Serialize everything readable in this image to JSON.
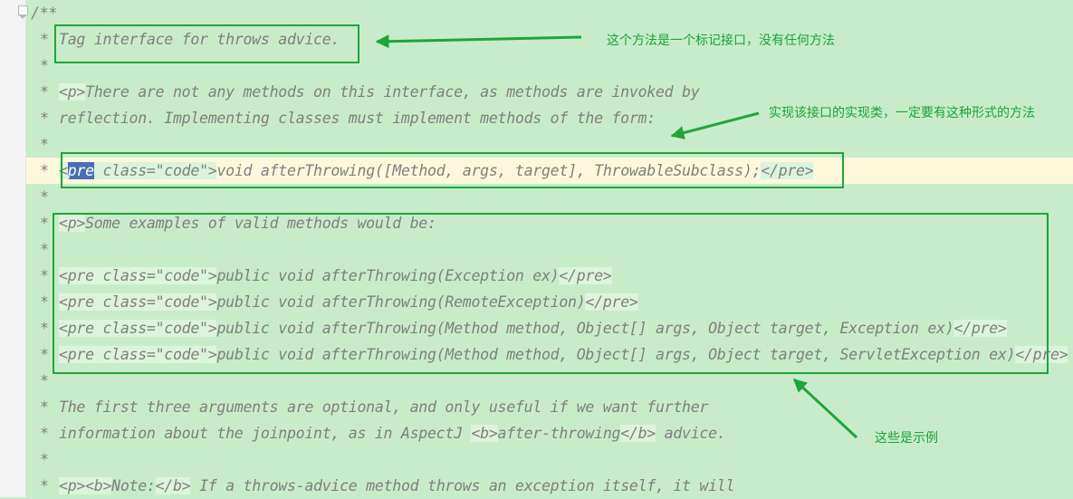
{
  "editor": {
    "lines": [
      {
        "star": "",
        "text": "/**",
        "first": true
      },
      {
        "star": "*",
        "text": "Tag interface for throws advice."
      },
      {
        "star": "*",
        "text": ""
      },
      {
        "star": "*",
        "text": "<p>There are not any methods on this interface, as methods are invoked by"
      },
      {
        "star": "*",
        "text": "reflection. Implementing classes must implement methods of the form:"
      },
      {
        "star": "*",
        "text": ""
      },
      {
        "star": "*",
        "text": "<pre class=\"code\">void afterThrowing([Method, args, target], ThrowableSubclass);</pre>",
        "highlight": true
      },
      {
        "star": "*",
        "text": ""
      },
      {
        "star": "*",
        "text": "<p>Some examples of valid methods would be:"
      },
      {
        "star": "*",
        "text": ""
      },
      {
        "star": "*",
        "text": "<pre class=\"code\">public void afterThrowing(Exception ex)</pre>"
      },
      {
        "star": "*",
        "text": "<pre class=\"code\">public void afterThrowing(RemoteException)</pre>"
      },
      {
        "star": "*",
        "text": "<pre class=\"code\">public void afterThrowing(Method method, Object[] args, Object target, Exception ex)</pre>"
      },
      {
        "star": "*",
        "text": "<pre class=\"code\">public void afterThrowing(Method method, Object[] args, Object target, ServletException ex)</pre>"
      },
      {
        "star": "*",
        "text": ""
      },
      {
        "star": "*",
        "text": "The first three arguments are optional, and only useful if we want further"
      },
      {
        "star": "*",
        "text": "information about the joinpoint, as in AspectJ <b>after-throwing</b> advice."
      },
      {
        "star": "*",
        "text": ""
      },
      {
        "star": "*",
        "text": "<p><b>Note:</b> If a throws-advice method throws an exception itself, it will"
      }
    ]
  },
  "annotations": {
    "marker_interface": "这个方法是一个标记接口，没有任何方法",
    "method_form": "实现该接口的实现类，一定要有这种形式的方法",
    "examples": "这些是示例"
  },
  "colors": {
    "background": "#c8ecc9",
    "annotation": "#19a33a",
    "comment_text": "#7f7f7f",
    "selection": "#4a6eb3",
    "current_line": "#fdf8dc"
  }
}
